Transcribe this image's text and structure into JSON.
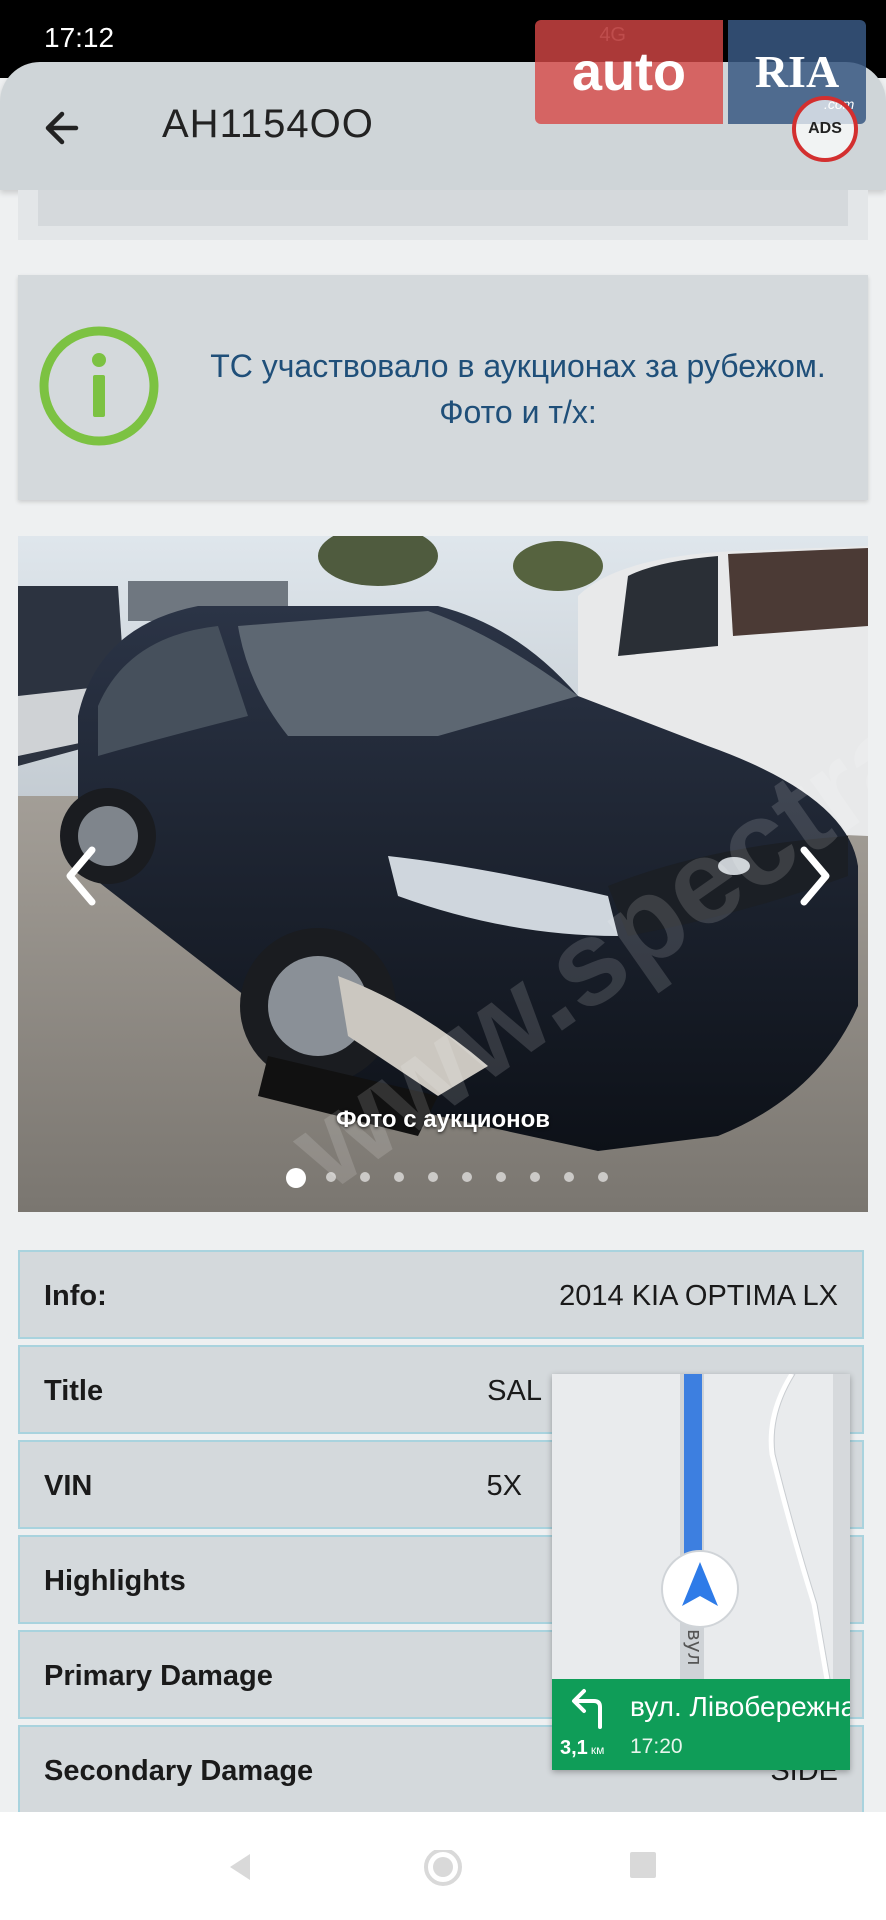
{
  "status_bar": {
    "time": "17:12",
    "network": "4G"
  },
  "app_bar": {
    "title": "AH1154OO"
  },
  "logo": {
    "auto": "auto",
    "ria": "RIA",
    "com": ".com",
    "ads": "ADS"
  },
  "info_card": {
    "message": "ТС участвовало в аукционах за рубежом. Фото и т/х:"
  },
  "carousel": {
    "caption": "Фото с аукционов",
    "total_photos": 10,
    "active_index": 0
  },
  "details": [
    {
      "label": "Info:",
      "value": "2014 KIA OPTIMA LX"
    },
    {
      "label": "Title",
      "value": "SAL"
    },
    {
      "label": "VIN",
      "value": "5X"
    },
    {
      "label": "Highlights",
      "value": ""
    },
    {
      "label": "Primary Damage",
      "value": ""
    },
    {
      "label": "Secondary Damage",
      "value": "SIDE"
    }
  ],
  "navigation": {
    "street": "вул. Лівобережна",
    "distance": "3,1",
    "distance_unit": "км",
    "eta": "17:20",
    "road_label": "вул"
  },
  "colors": {
    "accent_green": "#7cc242",
    "info_text": "#1f4f79",
    "row_border": "#a9d3de",
    "nav_green": "#0f9d58"
  }
}
